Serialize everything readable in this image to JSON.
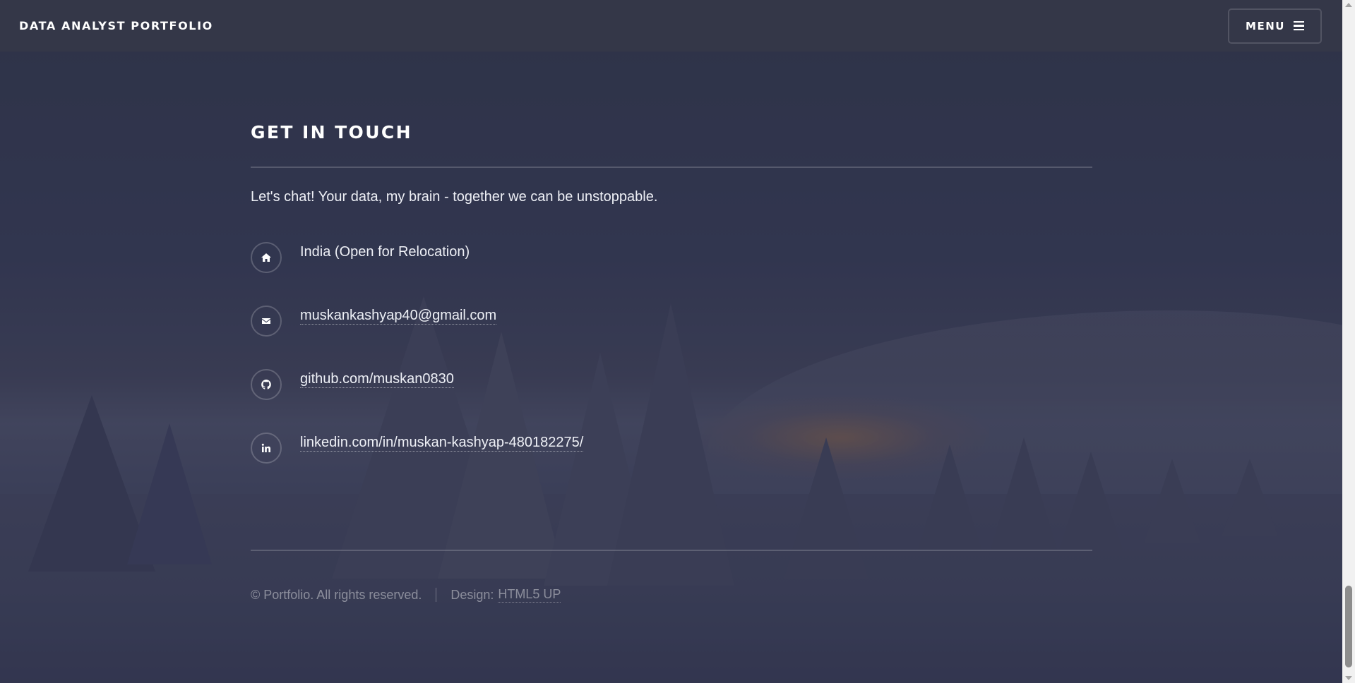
{
  "header": {
    "brand": "DATA ANALYST PORTFOLIO",
    "menu_label": "MENU"
  },
  "section": {
    "title": "GET IN TOUCH",
    "intro": "Let's chat! Your data, my brain - together we can be unstoppable."
  },
  "contacts": [
    {
      "icon": "home-icon",
      "text": "India (Open for Relocation)"
    },
    {
      "icon": "envelope-icon",
      "text": "muskankashyap40@gmail.com"
    },
    {
      "icon": "github-icon",
      "text": "github.com/muskan0830"
    },
    {
      "icon": "linkedin-icon",
      "text": "linkedin.com/in/muskan-kashyap-480182275/"
    }
  ],
  "footer": {
    "copyright": "© Portfolio. All rights reserved.",
    "design_label": "Design:",
    "design_link": "HTML5 UP"
  }
}
